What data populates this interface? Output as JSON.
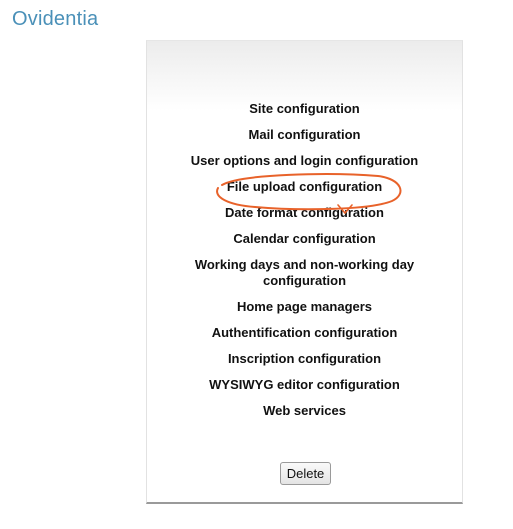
{
  "header": {
    "brand": "Ovidentia"
  },
  "menu": {
    "items": [
      "Site configuration",
      "Mail configuration",
      "User options and login configuration",
      "File upload configuration",
      "Date format configuration",
      "Calendar configuration",
      "Working days and non-working day configuration",
      "Home page managers",
      "Authentification configuration",
      "Inscription configuration",
      "WYSIWYG editor configuration",
      "Web services"
    ]
  },
  "actions": {
    "delete_label": "Delete"
  },
  "colors": {
    "brand": "#4a90b8",
    "annotation": "#e8622a"
  }
}
